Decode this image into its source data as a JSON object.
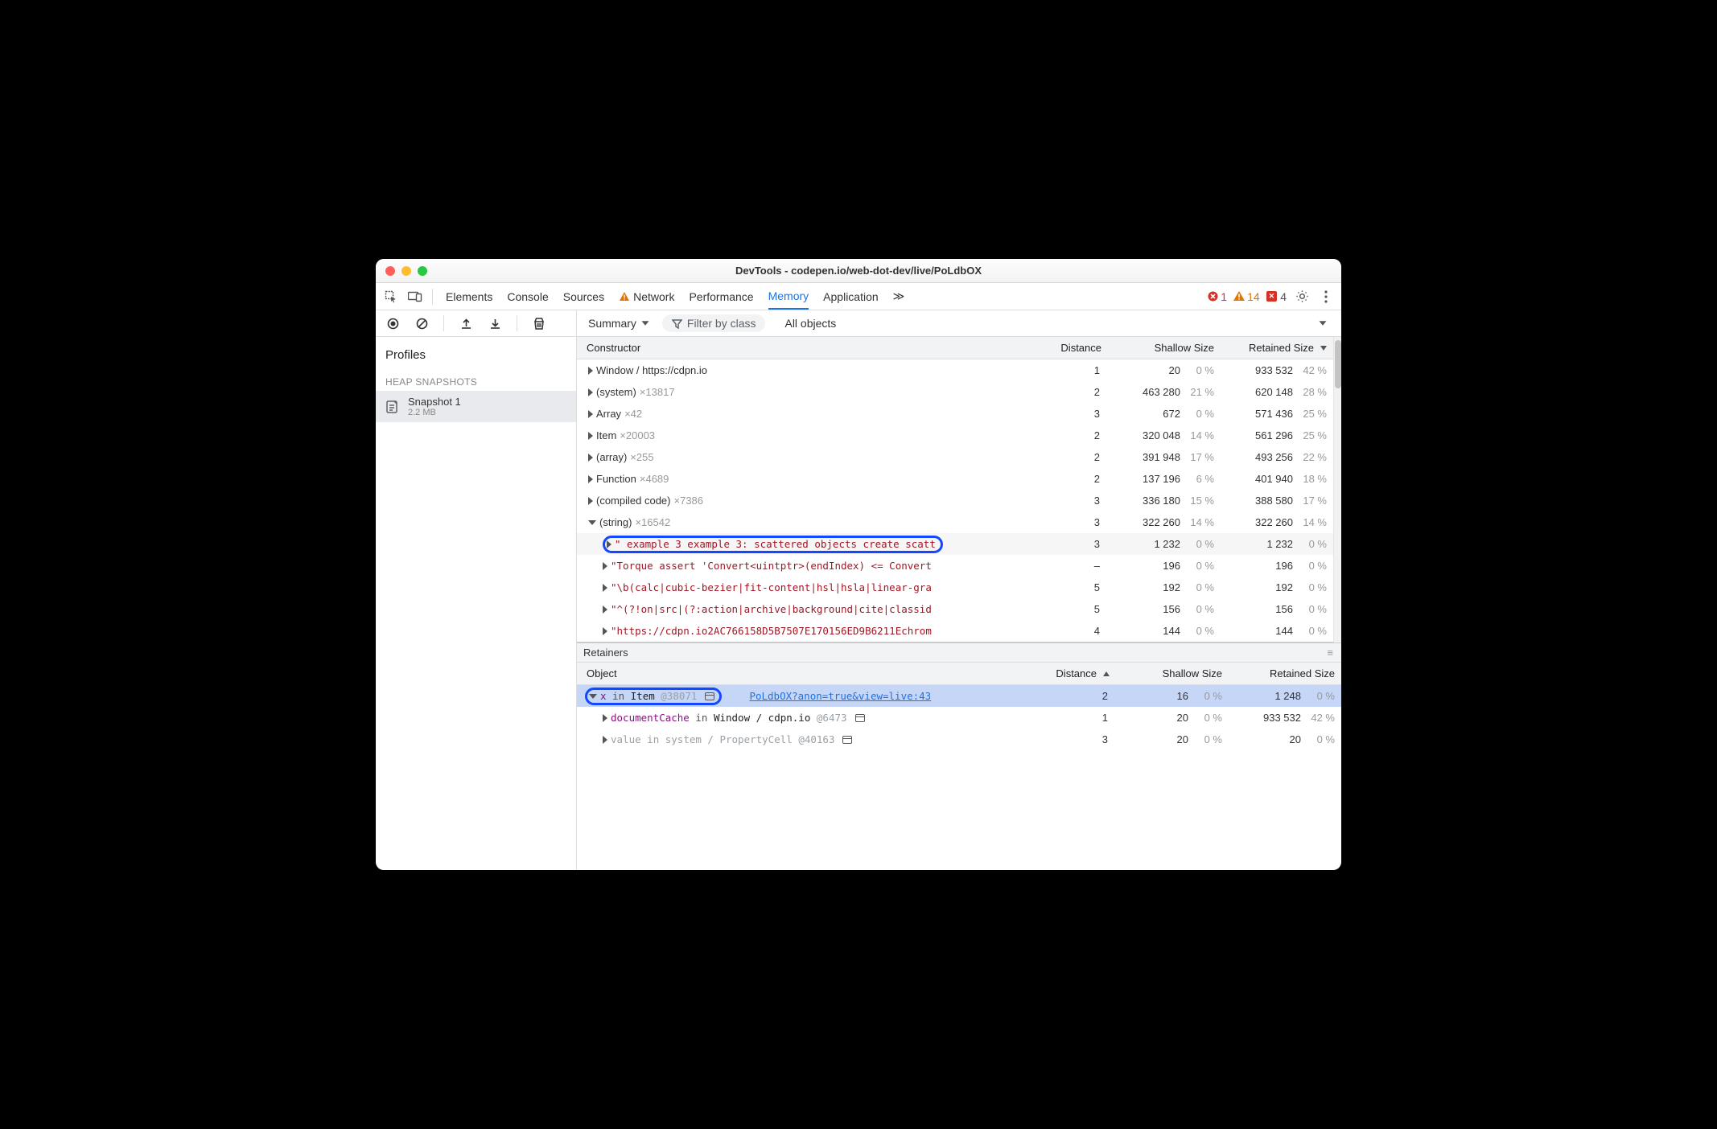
{
  "window": {
    "title": "DevTools - codepen.io/web-dot-dev/live/PoLdbOX"
  },
  "topbar": {
    "tabs": [
      "Elements",
      "Console",
      "Sources",
      "Network",
      "Performance",
      "Memory",
      "Application"
    ],
    "network_warn": true,
    "active_index": 5,
    "overflow_glyph": "≫",
    "errors": "1",
    "warnings": "14",
    "issues": "4"
  },
  "toolbar": {
    "summary_label": "Summary",
    "filter_placeholder": "Filter by class",
    "objects_label": "All objects"
  },
  "sidebar": {
    "profiles_label": "Profiles",
    "group_label": "HEAP SNAPSHOTS",
    "snapshot": {
      "name": "Snapshot 1",
      "size": "2.2 MB"
    }
  },
  "upper": {
    "columns": [
      "Constructor",
      "Distance",
      "Shallow Size",
      "Retained Size"
    ],
    "rows": [
      {
        "indent": 0,
        "arrow": "right",
        "label": "Window / https://cdpn.io",
        "count": "",
        "distance": "1",
        "shallow_val": "20",
        "shallow_pct": "0 %",
        "retained_val": "933 532",
        "retained_pct": "42 %"
      },
      {
        "indent": 0,
        "arrow": "right",
        "label": "(system)",
        "count": "×13817",
        "distance": "2",
        "shallow_val": "463 280",
        "shallow_pct": "21 %",
        "retained_val": "620 148",
        "retained_pct": "28 %"
      },
      {
        "indent": 0,
        "arrow": "right",
        "label": "Array",
        "count": "×42",
        "distance": "3",
        "shallow_val": "672",
        "shallow_pct": "0 %",
        "retained_val": "571 436",
        "retained_pct": "25 %"
      },
      {
        "indent": 0,
        "arrow": "right",
        "label": "Item",
        "count": "×20003",
        "distance": "2",
        "shallow_val": "320 048",
        "shallow_pct": "14 %",
        "retained_val": "561 296",
        "retained_pct": "25 %"
      },
      {
        "indent": 0,
        "arrow": "right",
        "label": "(array)",
        "count": "×255",
        "distance": "2",
        "shallow_val": "391 948",
        "shallow_pct": "17 %",
        "retained_val": "493 256",
        "retained_pct": "22 %"
      },
      {
        "indent": 0,
        "arrow": "right",
        "label": "Function",
        "count": "×4689",
        "distance": "2",
        "shallow_val": "137 196",
        "shallow_pct": "6 %",
        "retained_val": "401 940",
        "retained_pct": "18 %"
      },
      {
        "indent": 0,
        "arrow": "right",
        "label": "(compiled code)",
        "count": "×7386",
        "distance": "3",
        "shallow_val": "336 180",
        "shallow_pct": "15 %",
        "retained_val": "388 580",
        "retained_pct": "17 %"
      },
      {
        "indent": 0,
        "arrow": "down",
        "label": "(string)",
        "count": "×16542",
        "distance": "3",
        "shallow_val": "322 260",
        "shallow_pct": "14 %",
        "retained_val": "322 260",
        "retained_pct": "14 %"
      },
      {
        "indent": 1,
        "arrow": "right",
        "callout": true,
        "hl": true,
        "mono": true,
        "label": "\" example 3 example 3: scattered objects create scatt",
        "distance": "3",
        "shallow_val": "1 232",
        "shallow_pct": "0 %",
        "retained_val": "1 232",
        "retained_pct": "0 %"
      },
      {
        "indent": 1,
        "arrow": "right",
        "red": true,
        "label": "\"Torque assert 'Convert<uintptr>(endIndex) <= Convert",
        "distance": "–",
        "shallow_val": "196",
        "shallow_pct": "0 %",
        "retained_val": "196",
        "retained_pct": "0 %"
      },
      {
        "indent": 1,
        "arrow": "right",
        "red": true,
        "label": "\"\\b(calc|cubic-bezier|fit-content|hsl|hsla|linear-gra",
        "distance": "5",
        "shallow_val": "192",
        "shallow_pct": "0 %",
        "retained_val": "192",
        "retained_pct": "0 %"
      },
      {
        "indent": 1,
        "arrow": "right",
        "red": true,
        "label": "\"^(?!on|src|(?:action|archive|background|cite|classid",
        "distance": "5",
        "shallow_val": "156",
        "shallow_pct": "0 %",
        "retained_val": "156",
        "retained_pct": "0 %"
      },
      {
        "indent": 1,
        "arrow": "right",
        "red": true,
        "label": "\"https://cdpn.io2AC766158D5B7507E170156ED9B6211Echrom",
        "distance": "4",
        "shallow_val": "144",
        "shallow_pct": "0 %",
        "retained_val": "144",
        "retained_pct": "0 %"
      }
    ]
  },
  "retainers": {
    "title": "Retainers",
    "columns": [
      "Object",
      "Distance",
      "Shallow Size",
      "Retained Size"
    ],
    "rows": [
      {
        "arrow": "down",
        "callout": true,
        "selected": true,
        "parts": {
          "prop": "x",
          "in": " in ",
          "obj": "Item ",
          "id": "@38071"
        },
        "link": "PoLdbOX?anon=true&view=live:43",
        "distance": "2",
        "shallow_val": "16",
        "shallow_pct": "0 %",
        "retained_val": "1 248",
        "retained_pct": "0 %"
      },
      {
        "arrow": "right",
        "indent": 1,
        "parts": {
          "prop": "documentCache",
          "in": " in ",
          "obj": "Window / cdpn.io ",
          "id": "@6473"
        },
        "frame": true,
        "distance": "1",
        "shallow_val": "20",
        "shallow_pct": "0 %",
        "retained_val": "933 532",
        "retained_pct": "42 %"
      },
      {
        "arrow": "right",
        "indent": 1,
        "faded": true,
        "parts": {
          "prop": "value",
          "in": " in ",
          "obj": "system / PropertyCell ",
          "id": "@40163"
        },
        "distance": "3",
        "shallow_val": "20",
        "shallow_pct": "0 %",
        "retained_val": "20",
        "retained_pct": "0 %"
      }
    ]
  }
}
